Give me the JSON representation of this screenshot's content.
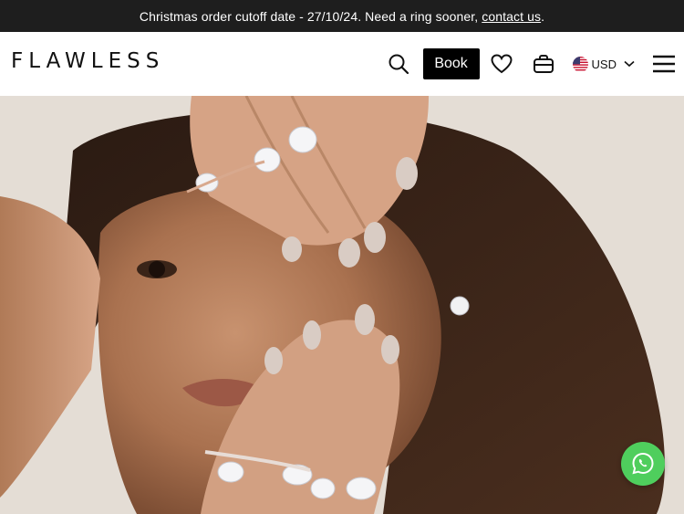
{
  "announcement": {
    "text": "Christmas order cutoff date - 27/10/24. Need a ring sooner,",
    "link_text": "contact us",
    "suffix": "."
  },
  "header": {
    "logo": "FLAWLESS",
    "book_label": "Book",
    "currency": "USD",
    "icons": [
      "search-icon",
      "heart-icon",
      "bag-icon",
      "us-flag-icon",
      "chevron-down-icon",
      "menu-icon"
    ]
  },
  "hero": {
    "image_alt": "Woman wearing diamond rings and earrings"
  },
  "floating": {
    "icon": "whatsapp-icon",
    "color": "#4fce5d"
  },
  "colors": {
    "announce_bg": "#1e1e1e",
    "book_bg": "#000000"
  }
}
